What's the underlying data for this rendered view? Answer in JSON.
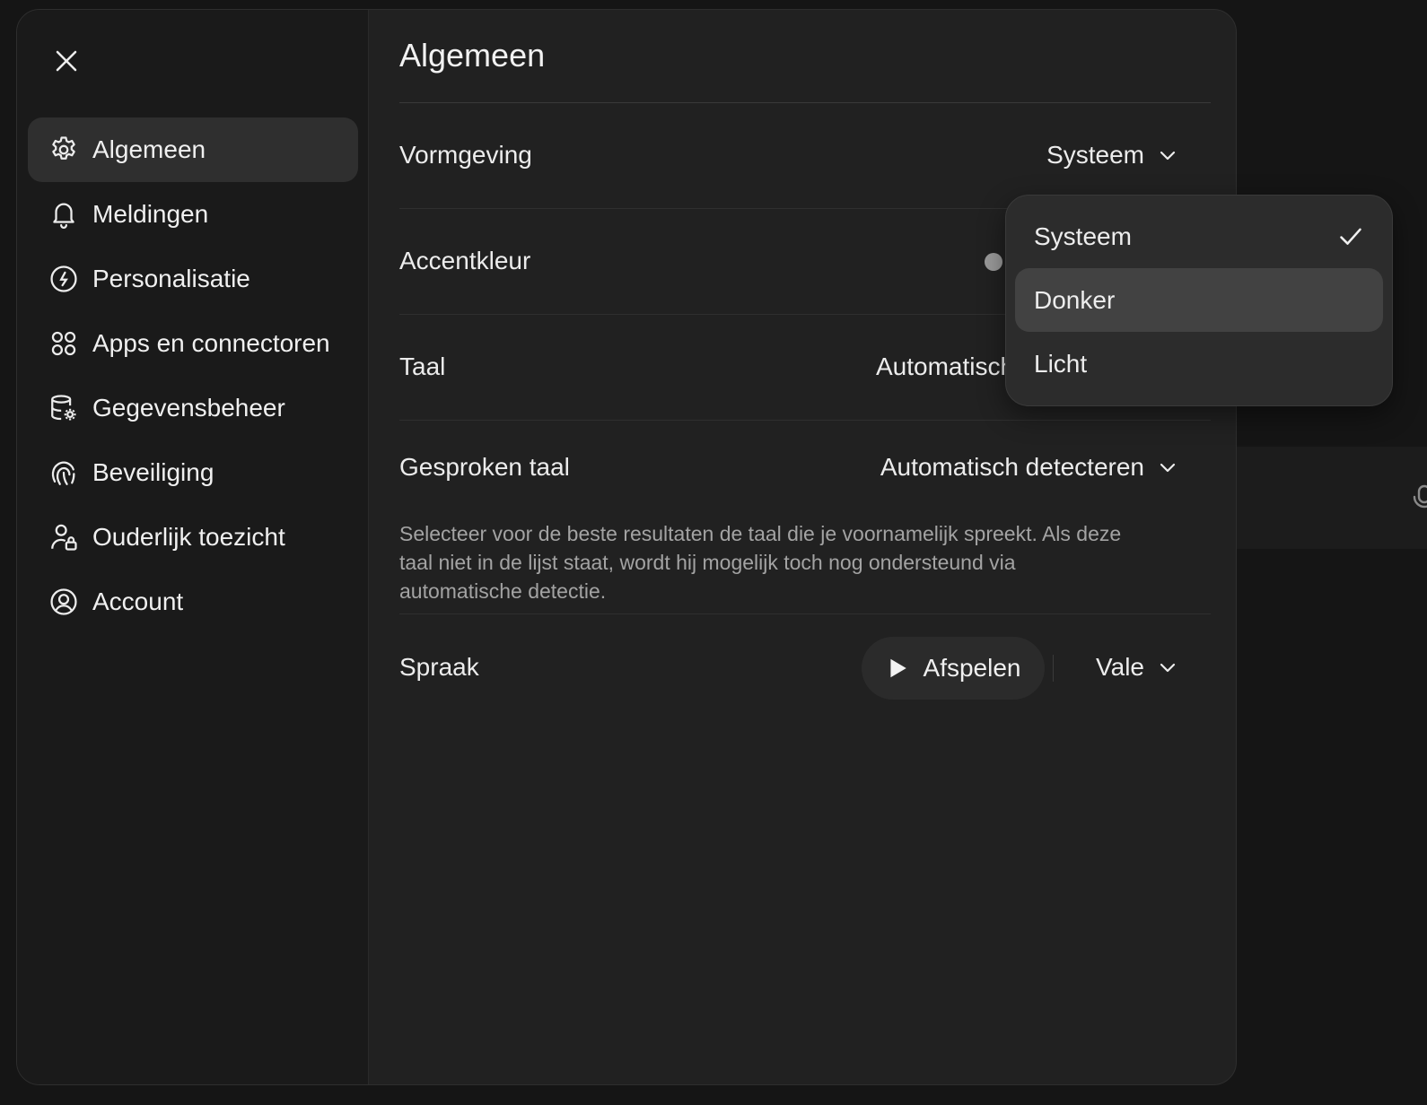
{
  "sidebar": {
    "items": [
      {
        "label": "Algemeen",
        "icon": "gear-icon",
        "active": true
      },
      {
        "label": "Meldingen",
        "icon": "bell-icon"
      },
      {
        "label": "Personalisatie",
        "icon": "personalization-icon"
      },
      {
        "label": "Apps en connectoren",
        "icon": "apps-icon"
      },
      {
        "label": "Gegevensbeheer",
        "icon": "database-gear-icon"
      },
      {
        "label": "Beveiliging",
        "icon": "fingerprint-icon"
      },
      {
        "label": "Ouderlijk toezicht",
        "icon": "user-lock-icon"
      },
      {
        "label": "Account",
        "icon": "user-circle-icon"
      }
    ]
  },
  "main": {
    "title": "Algemeen",
    "rows": {
      "appearance": {
        "label": "Vormgeving",
        "value": "Systeem"
      },
      "accent": {
        "label": "Accentkleur",
        "dot_color": "#9a9a9a"
      },
      "language": {
        "label": "Taal",
        "value": "Automatisch"
      },
      "spoken_language": {
        "label": "Gesproken taal",
        "value": "Automatisch detecteren",
        "description": "Selecteer voor de beste resultaten de taal die je voornamelijk spreekt. Als deze taal niet in de lijst staat, wordt hij mogelijk toch nog ondersteund via automatische detectie."
      },
      "voice": {
        "label": "Spraak",
        "play_label": "Afspelen",
        "value": "Vale"
      }
    }
  },
  "dropdown": {
    "options": [
      {
        "label": "Systeem",
        "selected": true
      },
      {
        "label": "Donker",
        "hovered": true
      },
      {
        "label": "Licht"
      }
    ]
  },
  "colors": {
    "modal_bg": "#212121",
    "sidebar_bg": "#1a1a1a",
    "active_item_bg": "#2f2f2f",
    "dropdown_bg": "#2c2c2c",
    "dropdown_hover_bg": "#424242"
  }
}
